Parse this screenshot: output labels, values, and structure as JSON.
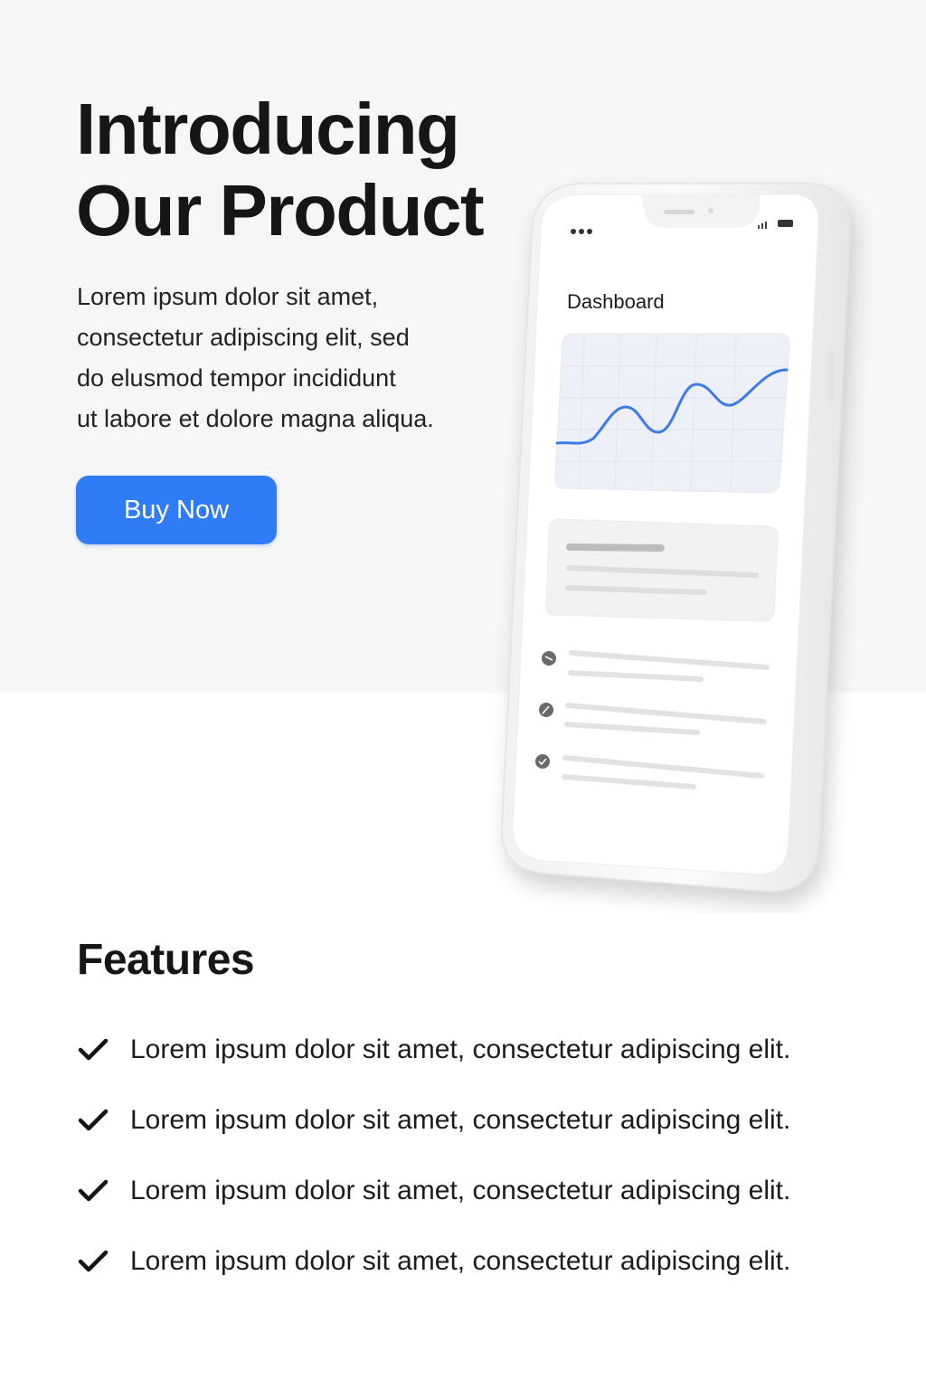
{
  "hero": {
    "title_lines": [
      "Introducing",
      "Our Product"
    ],
    "description_lines": [
      "Lorem ipsum dolor sit amet,",
      "consectetur adipiscing elit, sed",
      "do elusmod tempor incididunt",
      "ut labore et dolore magna aliqua."
    ],
    "buy_label": "Buy Now"
  },
  "phone": {
    "screen_title": "Dashboard",
    "status_bar": {
      "left_icon": "more-dots-icon",
      "right_icons": [
        "signal-icon",
        "battery-icon"
      ]
    },
    "list_item_icons": [
      "minus-circle-icon",
      "edit-circle-icon",
      "check-circle-icon"
    ]
  },
  "features": {
    "title": "Features",
    "items": [
      "Lorem ipsum dolor sit amet, consectetur adipiscing elit.",
      "Lorem ipsum dolor sit amet, consectetur adipiscing elit.",
      "Lorem ipsum dolor sit amet, consectetur adipiscing elit.",
      "Lorem ipsum dolor sit amet, consectetur adipiscing elit."
    ],
    "item_icon": "checkmark-icon"
  },
  "colors": {
    "accent": "#2f7cf6",
    "hero_background": "#f6f6f6",
    "chart_line": "#3b7bea",
    "chart_fill": "#eef0f8"
  }
}
